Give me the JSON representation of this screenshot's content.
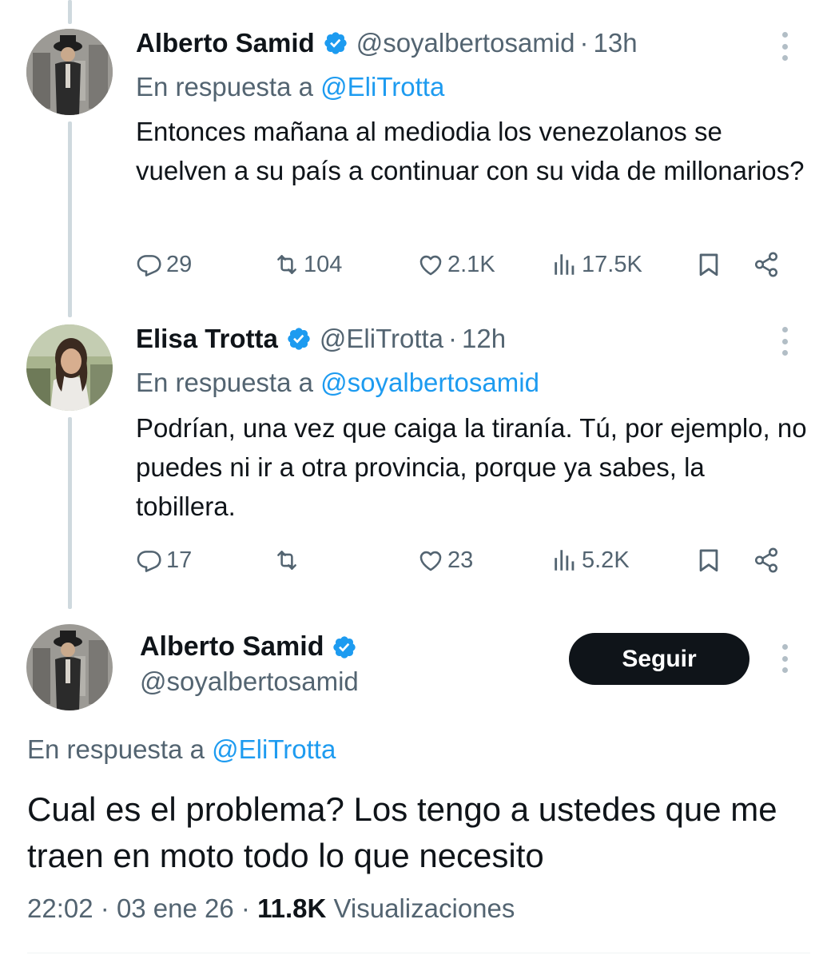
{
  "tweets": [
    {
      "name": "Alberto Samid",
      "handle": "@soyalbertosamid",
      "separator": "·",
      "time": "13h",
      "reply_prefix": "En respuesta a ",
      "reply_to": "@EliTrotta",
      "text": "Entonces mañana al mediodia los venezolanos se vuelven a su país a continuar con su vida de millonarios?",
      "replies": "29",
      "reposts": "104",
      "likes": "2.1K",
      "views": "17.5K"
    },
    {
      "name": "Elisa Trotta",
      "handle": "@EliTrotta",
      "separator": "·",
      "time": "12h",
      "reply_prefix": "En respuesta a ",
      "reply_to": "@soyalbertosamid",
      "text": "Podrían, una vez que caiga la tiranía. Tú, por ejemplo, no puedes ni ir a otra provincia, porque ya sabes, la tobillera.",
      "replies": "17",
      "reposts": "",
      "likes": "23",
      "views": "5.2K"
    }
  ],
  "main_tweet": {
    "name": "Alberto Samid",
    "handle": "@soyalbertosamid",
    "follow_label": "Seguir",
    "reply_prefix": "En respuesta a ",
    "reply_to": "@EliTrotta",
    "text": "Cual es el problema? Los tengo a ustedes que me traen en moto todo lo que necesito",
    "time": "22:02",
    "separator": "·",
    "date": "03 ene 26",
    "views_count": "11.8K",
    "views_label": "Visualizaciones"
  },
  "colors": {
    "text": "#0f1419",
    "secondary": "#536471",
    "link": "#1d9bf0",
    "verified": "#1d9bf0",
    "button_bg": "#0f1419"
  },
  "icons": [
    "verified-badge-icon",
    "more-icon",
    "reply-icon",
    "repost-icon",
    "like-icon",
    "views-icon",
    "bookmark-icon",
    "share-icon"
  ]
}
